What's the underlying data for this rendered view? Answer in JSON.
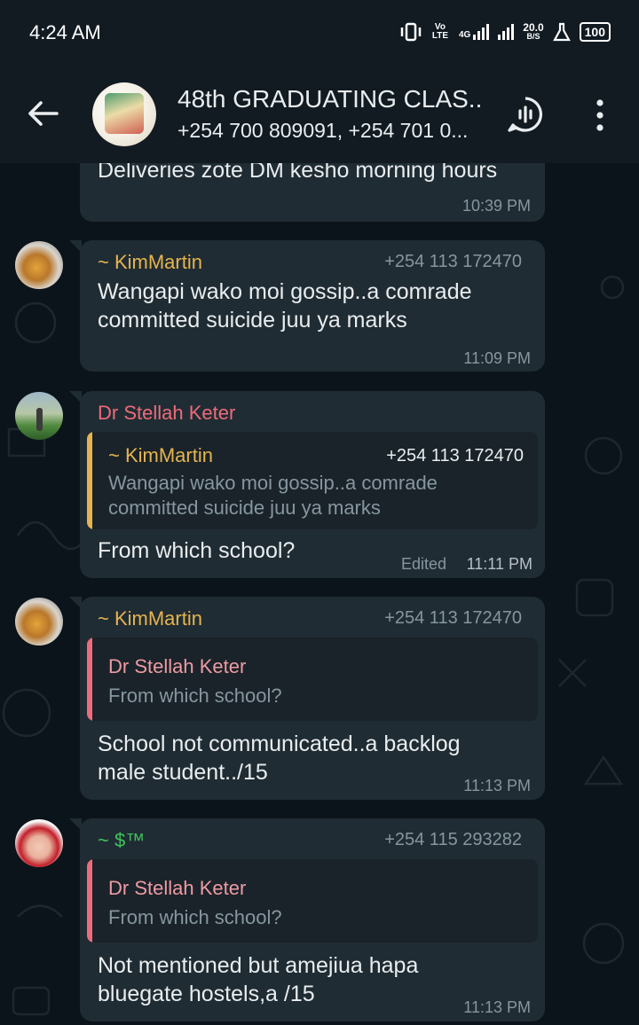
{
  "status_bar": {
    "time": "4:24 AM",
    "vo_lte": "Vo LTE",
    "network": "4G",
    "speed_value": "20.0",
    "speed_unit": "B/S",
    "battery": "100"
  },
  "header": {
    "title": "48th GRADUATING CLAS...",
    "subtitle": "+254 700 809091, +254 701 0...",
    "icons": [
      "back-arrow-icon",
      "group-avatar",
      "voice-chat-icon",
      "more-vert-icon"
    ]
  },
  "colors": {
    "bubble": "#202c33",
    "background": "#0b141a",
    "kimmartin_name": "#e6b450",
    "stellah_name": "#ee6b7a",
    "s_name": "#3fc35b",
    "muted": "#8696a0"
  },
  "messages": [
    {
      "text": "Deliveries zote DM kesho morning hours",
      "time": "10:39 PM"
    },
    {
      "sender": "~ KimMartin",
      "phone": "+254 113 172470",
      "text": "Wangapi wako moi gossip..a comrade committed suicide juu ya marks",
      "time": "11:09 PM"
    },
    {
      "sender": "Dr Stellah Keter",
      "quote": {
        "sender": "~ KimMartin",
        "phone": "+254 113 172470",
        "text": "Wangapi wako moi gossip..a comrade committed suicide juu ya marks"
      },
      "text": "From which  school?",
      "edited": "Edited",
      "time": "11:11 PM"
    },
    {
      "sender": "~ KimMartin",
      "phone": "+254 113 172470",
      "quote": {
        "sender": "Dr Stellah Keter",
        "text": "From which  school?"
      },
      "text": "School not communicated..a backlog male student../15",
      "time": "11:13 PM"
    },
    {
      "sender": "~ $™",
      "phone": "+254 115 293282",
      "quote": {
        "sender": "Dr Stellah Keter",
        "text": "From which  school?"
      },
      "text": "Not mentioned but amejiua hapa bluegate hostels,a /15",
      "time": "11:13 PM"
    }
  ]
}
